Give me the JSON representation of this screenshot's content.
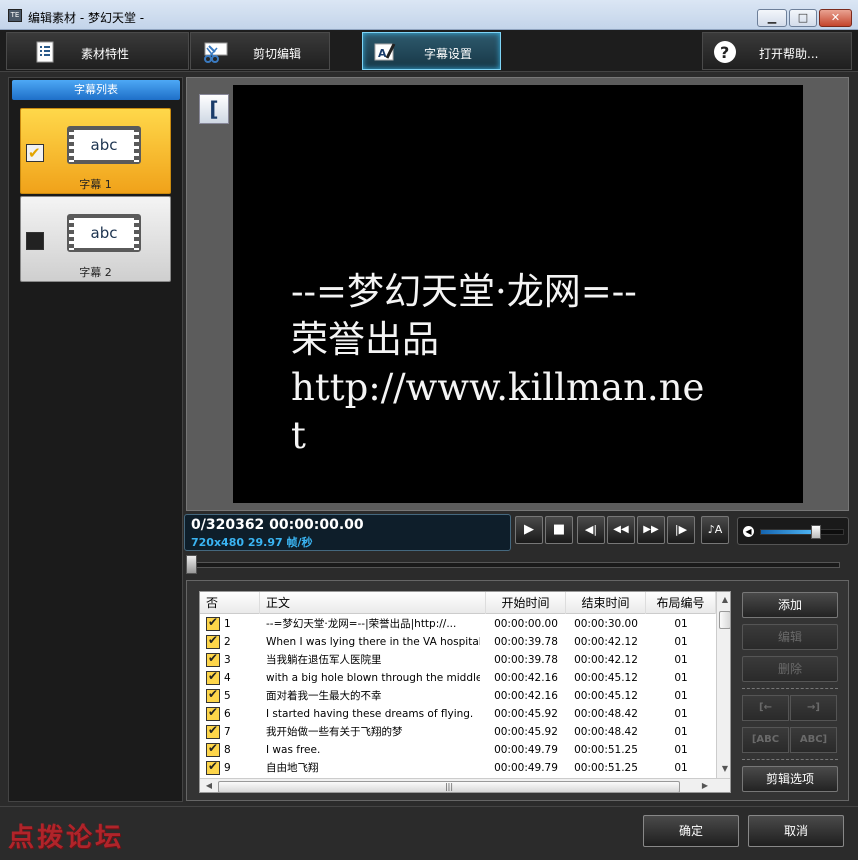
{
  "window": {
    "title": "编辑素材 - 梦幻天堂 -",
    "minimize_icon": "minimize-icon",
    "maximize_icon": "maximize-icon",
    "close_icon": "close-icon"
  },
  "tabs": [
    {
      "label": "素材特性",
      "icon": "properties-icon",
      "active": false
    },
    {
      "label": "剪切编辑",
      "icon": "cut-edit-icon",
      "active": false
    },
    {
      "label": "字幕设置",
      "icon": "subtitle-settings-icon",
      "active": true
    },
    {
      "label": "打开帮助...",
      "icon": "help-icon",
      "active": false
    }
  ],
  "subtitle_list": {
    "header": "字幕列表",
    "items": [
      {
        "name": "字幕 1",
        "thumb_text": "abc",
        "checked": true,
        "selected": true
      },
      {
        "name": "字幕 2",
        "thumb_text": "abc",
        "checked": false,
        "selected": false
      }
    ]
  },
  "preview": {
    "bracket_label": "[",
    "lines": [
      "--=梦幻天堂·龙网=--",
      "荣誉出品",
      "http://www.killman.ne",
      "t"
    ]
  },
  "timecode": {
    "main": "0/320362  00:00:00.00",
    "info": "720x480 29.97 帧/秒"
  },
  "transport": {
    "buttons": [
      {
        "name": "play-icon",
        "glyph": "▶"
      },
      {
        "name": "stop-icon",
        "glyph": "■"
      },
      {
        "name": "prev-frame-icon",
        "glyph": "◀|"
      },
      {
        "name": "rewind-icon",
        "glyph": "◀◀"
      },
      {
        "name": "fast-forward-icon",
        "glyph": "▶▶"
      },
      {
        "name": "next-frame-icon",
        "glyph": "|▶"
      },
      {
        "name": "audio-icon",
        "glyph": "♪A"
      }
    ],
    "volume_level": 0.65,
    "scrub_position": 0
  },
  "table": {
    "columns": [
      "否",
      "正文",
      "开始时间",
      "结束时间",
      "布局编号"
    ],
    "rows": [
      {
        "no": "1",
        "text": "--=梦幻天堂·龙网=--|荣誉出品|http://...",
        "start": "00:00:00.00",
        "end": "00:00:30.00",
        "layout": "01"
      },
      {
        "no": "2",
        "text": "When I was lying there in the VA hospital,",
        "start": "00:00:39.78",
        "end": "00:00:42.12",
        "layout": "01"
      },
      {
        "no": "3",
        "text": "当我躺在退伍军人医院里",
        "start": "00:00:39.78",
        "end": "00:00:42.12",
        "layout": "01"
      },
      {
        "no": "4",
        "text": "with a big hole blown through the middle ...",
        "start": "00:00:42.16",
        "end": "00:00:45.12",
        "layout": "01"
      },
      {
        "no": "5",
        "text": "面对着我一生最大的不幸",
        "start": "00:00:42.16",
        "end": "00:00:45.12",
        "layout": "01"
      },
      {
        "no": "6",
        "text": "I started having these dreams of flying.",
        "start": "00:00:45.92",
        "end": "00:00:48.42",
        "layout": "01"
      },
      {
        "no": "7",
        "text": "我开始做一些有关于飞翔的梦",
        "start": "00:00:45.92",
        "end": "00:00:48.42",
        "layout": "01"
      },
      {
        "no": "8",
        "text": "I was free.",
        "start": "00:00:49.79",
        "end": "00:00:51.25",
        "layout": "01"
      },
      {
        "no": "9",
        "text": "自由地飞翔",
        "start": "00:00:49.79",
        "end": "00:00:51.25",
        "layout": "01"
      }
    ]
  },
  "side_buttons": {
    "add": "添加",
    "edit": "编辑",
    "delete": "删除",
    "move_left": "[←",
    "move_right": "→]",
    "abc_left": "[ABC",
    "abc_right": "ABC]",
    "edit_options": "剪辑选项"
  },
  "footer": {
    "watermark": "点拨论坛",
    "ok": "确定",
    "cancel": "取消"
  }
}
